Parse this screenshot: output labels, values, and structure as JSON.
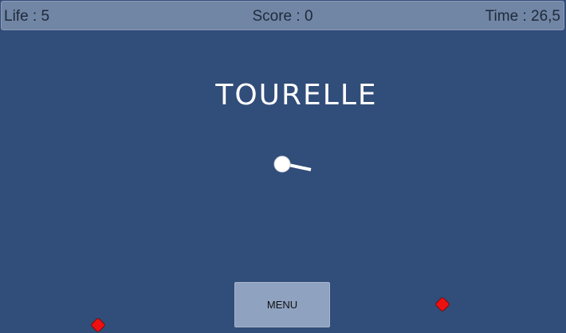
{
  "hud": {
    "life": "Life : 5",
    "score": "Score : 0",
    "time": "Time : 26,5"
  },
  "title": "TOURELLE",
  "menu": {
    "label": "MENU"
  },
  "colors": {
    "background": "#314d79",
    "hud_bar": "#7185a5",
    "enemy": "#ee1010",
    "button": "#8fa2c0"
  },
  "sprites": {
    "turret": "turret-icon",
    "enemy": "enemy-diamond-icon"
  }
}
